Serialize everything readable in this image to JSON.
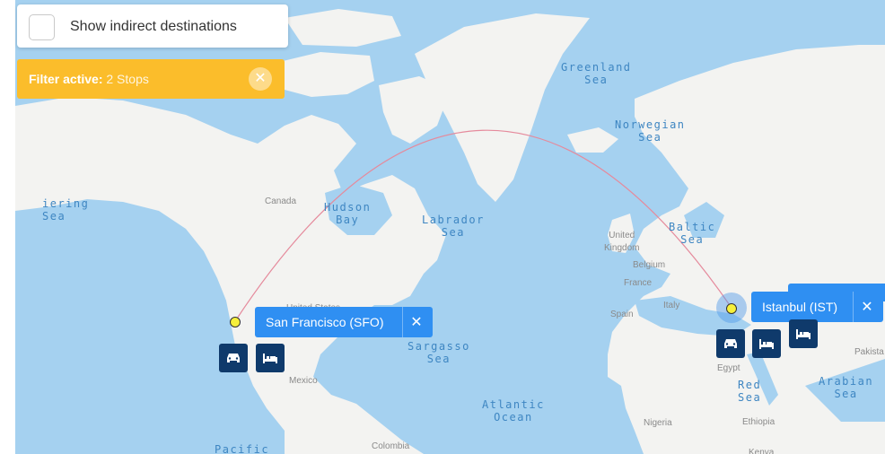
{
  "toggle": {
    "label": "Show indirect destinations",
    "checked": false
  },
  "filter": {
    "prefix": "Filter active:",
    "value": "2 Stops",
    "close": "✕"
  },
  "origin": {
    "label": "San Francisco (SFO)",
    "close": "✕"
  },
  "destination": {
    "label": "Istanbul (IST)",
    "close": "✕"
  },
  "map_labels": {
    "greenland_sea": "Greenland\nSea",
    "norwegian_sea": "Norwegian\nSea",
    "bering_sea": "iering\nSea",
    "hudson_bay": "Hudson\nBay",
    "labrador_sea": "Labrador\nSea",
    "baltic_sea": "Baltic\nSea",
    "sargasso_sea": "Sargasso\nSea",
    "atlantic_ocean": "Atlantic\nOcean",
    "red_sea": "Red\nSea",
    "arabian_sea": "Arabian\nSea",
    "pacific": "Pacific",
    "canada": "Canada",
    "united_states": "United States",
    "mexico": "Mexico",
    "colombia": "Colombia",
    "united_kingdom": "United\nKingdom",
    "belgium": "Belgium",
    "france": "France",
    "spain": "Spain",
    "italy": "Italy",
    "egypt": "Egypt",
    "nigeria": "Nigeria",
    "ethiopia": "Ethiopia",
    "kenya": "Kenya",
    "pakistan": "Pakista"
  },
  "colors": {
    "water": "#a5d1f0",
    "land": "#f3f3f1",
    "filter": "#fbbd2b",
    "tooltip": "#2f8ff2",
    "button": "#0f3a6b",
    "route": "#e58a9c"
  },
  "icons": [
    "car-icon",
    "bed-icon",
    "close-icon",
    "checkbox-icon"
  ]
}
